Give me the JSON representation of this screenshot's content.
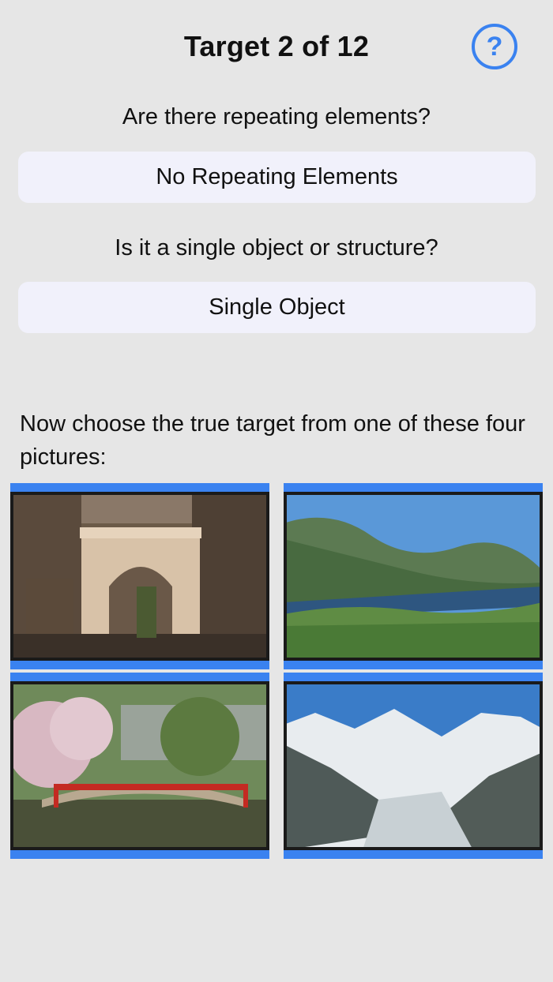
{
  "header": {
    "title": "Target 2 of 12",
    "help_label": "?"
  },
  "questions": [
    {
      "prompt": "Are there repeating elements?",
      "answer": "No Repeating Elements"
    },
    {
      "prompt": "Is it a single object or structure?",
      "answer": "Single Object"
    }
  ],
  "instructions": "Now choose the true target from one of these four pictures:",
  "pictures": [
    {
      "subject": "stone arch in city"
    },
    {
      "subject": "mountain lake"
    },
    {
      "subject": "red bridge with cherry blossoms"
    },
    {
      "subject": "snowy mountains and glacier"
    }
  ],
  "colors": {
    "accent": "#3a82f0",
    "background": "#e6e6e6",
    "answer_bg": "#f1f1fb"
  }
}
